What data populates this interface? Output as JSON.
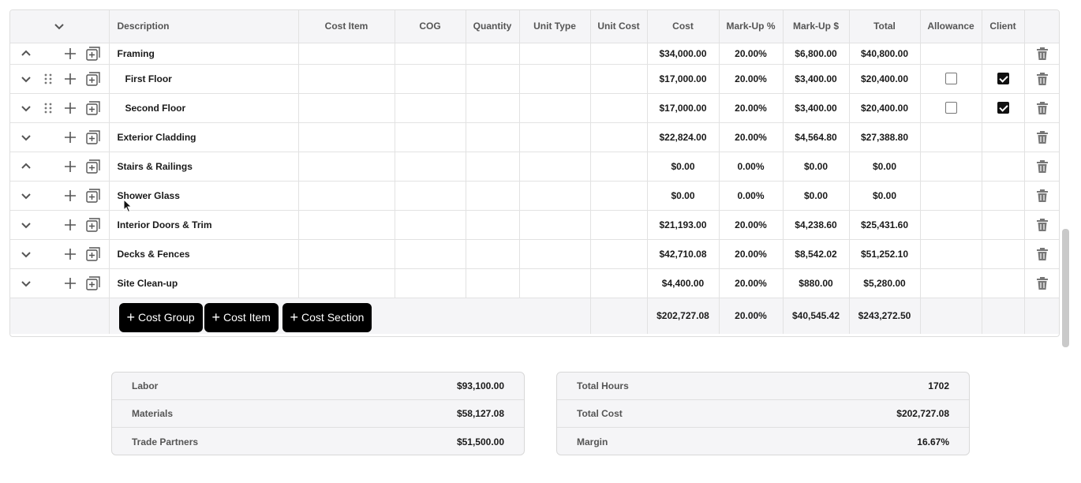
{
  "columns": [
    "Description",
    "Cost Item",
    "COG",
    "Quantity",
    "Unit Type",
    "Unit Cost",
    "Cost",
    "Mark-Up %",
    "Mark-Up $",
    "Total",
    "Allowance",
    "Client"
  ],
  "rows": [
    {
      "description": "Framing",
      "cost": "$34,000.00",
      "markup_pct": "20.00%",
      "markup_amt": "$6,800.00",
      "total": "$40,800.00",
      "expanded": true,
      "child": false
    },
    {
      "description": "First Floor",
      "cost": "$17,000.00",
      "markup_pct": "20.00%",
      "markup_amt": "$3,400.00",
      "total": "$20,400.00",
      "expanded": false,
      "child": true,
      "allowance": false,
      "client": true
    },
    {
      "description": "Second Floor",
      "cost": "$17,000.00",
      "markup_pct": "20.00%",
      "markup_amt": "$3,400.00",
      "total": "$20,400.00",
      "expanded": false,
      "child": true,
      "allowance": false,
      "client": true
    },
    {
      "description": "Exterior Cladding",
      "cost": "$22,824.00",
      "markup_pct": "20.00%",
      "markup_amt": "$4,564.80",
      "total": "$27,388.80",
      "expanded": false,
      "child": false
    },
    {
      "description": "Stairs & Railings",
      "cost": "$0.00",
      "markup_pct": "0.00%",
      "markup_amt": "$0.00",
      "total": "$0.00",
      "expanded": true,
      "child": false
    },
    {
      "description": "Shower Glass",
      "cost": "$0.00",
      "markup_pct": "0.00%",
      "markup_amt": "$0.00",
      "total": "$0.00",
      "expanded": false,
      "child": false
    },
    {
      "description": "Interior Doors & Trim",
      "cost": "$21,193.00",
      "markup_pct": "20.00%",
      "markup_amt": "$4,238.60",
      "total": "$25,431.60",
      "expanded": false,
      "child": false
    },
    {
      "description": "Decks & Fences",
      "cost": "$42,710.08",
      "markup_pct": "20.00%",
      "markup_amt": "$8,542.02",
      "total": "$51,252.10",
      "expanded": false,
      "child": false
    },
    {
      "description": "Site Clean-up",
      "cost": "$4,400.00",
      "markup_pct": "20.00%",
      "markup_amt": "$880.00",
      "total": "$5,280.00",
      "expanded": false,
      "child": false
    }
  ],
  "footer": {
    "buttons": {
      "cost_group": "Cost Group",
      "cost_item": "Cost Item",
      "cost_section": "Cost Section"
    },
    "cost": "$202,727.08",
    "markup_pct": "20.00%",
    "markup_amt": "$40,545.42",
    "total": "$243,272.50"
  },
  "summary_left": [
    {
      "label": "Labor",
      "value": "$93,100.00"
    },
    {
      "label": "Materials",
      "value": "$58,127.08"
    },
    {
      "label": "Trade Partners",
      "value": "$51,500.00"
    }
  ],
  "summary_right": [
    {
      "label": "Total Hours",
      "value": "1702"
    },
    {
      "label": "Total Cost",
      "value": "$202,727.08"
    },
    {
      "label": "Margin",
      "value": "16.67%"
    }
  ],
  "icons": {
    "collapse": "chevron-down-icon",
    "expand": "chevron-up-icon",
    "drag": "drag-handle-icon",
    "add": "plus-icon",
    "add_sub": "add-subitem-icon",
    "delete": "trash-icon"
  },
  "colors": {
    "button_bg": "#000000",
    "header_bg": "#f5f5f7",
    "icon": "#555555"
  }
}
